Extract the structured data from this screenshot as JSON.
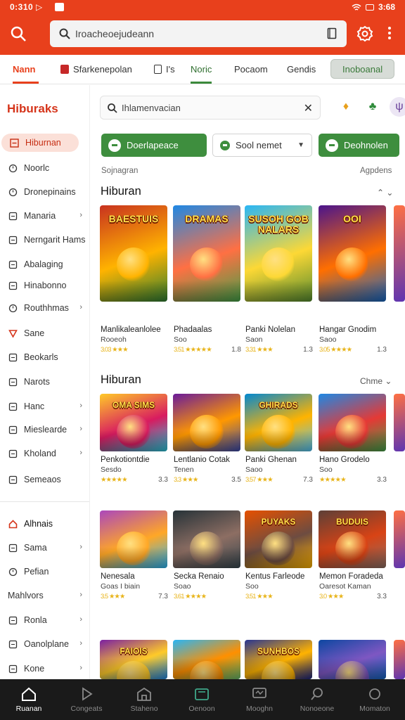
{
  "status_bar": {
    "time": "0:310 ▷",
    "right": "3:68"
  },
  "app_bar": {
    "search_text": "Iroacheoejudeann"
  },
  "tabs": [
    {
      "label": "Nann"
    },
    {
      "label": "Sfarkenepolan"
    },
    {
      "label": "I's"
    },
    {
      "label": "Noric"
    },
    {
      "label": "Pocaom"
    },
    {
      "label": "Gendis"
    },
    {
      "label": "Inoboanal"
    }
  ],
  "sidebar": {
    "title": "Hiburaks",
    "items": [
      {
        "label": "Hiburnan",
        "icon": "list-icon"
      },
      {
        "label": "Noorlc",
        "icon": "clock-icon"
      },
      {
        "label": "Dronepinains",
        "icon": "timer-icon"
      },
      {
        "label": "Manaria",
        "icon": "globe-icon"
      },
      {
        "label": "Nerngarit Hams",
        "icon": "pencil-icon"
      },
      {
        "label": "Abalaging",
        "icon": "chat-icon"
      },
      {
        "label": "Hinabonno",
        "icon": "bookmark-icon"
      },
      {
        "label": "Routhhmas",
        "icon": "clock-icon"
      },
      {
        "label": "Sane",
        "icon": "shield-icon"
      },
      {
        "label": "Beokarls",
        "icon": "book-icon"
      },
      {
        "label": "Narots",
        "icon": "gamepad-icon"
      },
      {
        "label": "Hanc",
        "icon": "controller-icon"
      },
      {
        "label": "Mieslearde",
        "icon": "doc-icon"
      },
      {
        "label": "Kholand",
        "icon": "puzzle-icon"
      },
      {
        "label": "Semeaos",
        "icon": "cards-icon"
      },
      {
        "label": "Alhnais",
        "icon": "home-icon"
      },
      {
        "label": "Sama",
        "icon": "doc-icon"
      },
      {
        "label": "Pefian",
        "icon": "circle-icon"
      },
      {
        "label": "Mahlvors",
        "icon": "none"
      },
      {
        "label": "Ronla",
        "icon": "square-icon"
      },
      {
        "label": "Oanolplane",
        "icon": "doc-icon"
      },
      {
        "label": "Kone",
        "icon": "square-icon"
      }
    ]
  },
  "main": {
    "search_text": "Ihlamenvacian",
    "filters": [
      {
        "label": "Doerlapeace"
      },
      {
        "label": "Sool nemet"
      },
      {
        "label": "Deohnolen"
      }
    ],
    "sub_left": "Sojnagran",
    "sub_right": "Agpdens",
    "sections": [
      {
        "title": "Hiburan",
        "action": "⌃ ⌄",
        "cards": [
          {
            "art_title": "BAESTUIS",
            "name": "Manlikaleanlolee",
            "sub": "Rooeoh",
            "meta": "3.03 ★★★",
            "num": "",
            "colors": [
              "#c8321f",
              "#ffb300",
              "#2e7d32"
            ]
          },
          {
            "art_title": "DRAMAS",
            "name": "Phadaalas",
            "sub": "Soo",
            "meta": "3.51 ★★★★★",
            "num": "1.8",
            "colors": [
              "#1e88e5",
              "#ff7043",
              "#43a047"
            ]
          },
          {
            "art_title": "SUSOH GOB NALARS",
            "name": "Panki Nolelan",
            "sub": "Saon",
            "meta": "3.31 ★★★",
            "num": "1.3",
            "colors": [
              "#29b6f6",
              "#fdd835",
              "#558b2f"
            ]
          },
          {
            "art_title": "OOI",
            "name": "Hangar Gnodim",
            "sub": "Saoo",
            "meta": "3.05 ★★★★",
            "num": "1.3",
            "colors": [
              "#4a148c",
              "#ff6f00",
              "#1565c0"
            ]
          }
        ]
      },
      {
        "title": "Hiburan",
        "action": "Chme ⌄",
        "cards": [
          {
            "art_title": "OMA SIMS",
            "name": "Penkotiontdie",
            "sub": "Sesdo",
            "meta": "★★★★★",
            "num": "3.3",
            "colors": [
              "#ffca28",
              "#d81b60",
              "#26c6da"
            ]
          },
          {
            "art_title": "",
            "name": "Lentlanio Cotak",
            "sub": "Tenen",
            "meta": "3.3 ★★★",
            "num": "3.5",
            "colors": [
              "#6a1b9a",
              "#ff9800",
              "#3949ab"
            ]
          },
          {
            "art_title": "GHIRADS",
            "name": "Panki Ghenan",
            "sub": "Saoo",
            "meta": "3.57 ★★★",
            "num": "7.3",
            "colors": [
              "#0288d1",
              "#ffb300",
              "#4fc3f7"
            ]
          },
          {
            "art_title": "",
            "name": "Hano Grodelo",
            "sub": "Soo",
            "meta": "★★★★★",
            "num": "3.3",
            "colors": [
              "#1e88e5",
              "#e53935",
              "#43a047"
            ]
          }
        ]
      },
      {
        "title": "",
        "action": "",
        "cards": [
          {
            "art_title": "",
            "name": "Nenesala",
            "sub": "Goas I biain",
            "meta": "3.5 ★★★",
            "num": "7.3",
            "colors": [
              "#ab47bc",
              "#ffa726",
              "#29b6f6"
            ]
          },
          {
            "art_title": "",
            "name": "Secka Renaio",
            "sub": "Soao",
            "meta": "3.61 ★★★★",
            "num": "",
            "colors": [
              "#263238",
              "#8d6e63",
              "#37474f"
            ]
          },
          {
            "art_title": "PUYAKS",
            "name": "Kentus Farleode",
            "sub": "Soo",
            "meta": "3.51 ★★★",
            "num": "",
            "colors": [
              "#e65100",
              "#6d4c41",
              "#ffb300"
            ]
          },
          {
            "art_title": "BUDUIS",
            "name": "Memon Foradeda",
            "sub": "Oaresot Kaman",
            "meta": "3.0 ★★★",
            "num": "3.3",
            "colors": [
              "#5d4037",
              "#d84315",
              "#8d6e63"
            ]
          }
        ]
      },
      {
        "title": "",
        "action": "",
        "cards": [
          {
            "art_title": "FAIOIS",
            "name": "",
            "sub": "",
            "meta": "",
            "num": "",
            "colors": [
              "#7b1fa2",
              "#ffca28",
              "#1e88e5"
            ]
          },
          {
            "art_title": "",
            "name": "",
            "sub": "",
            "meta": "",
            "num": "",
            "colors": [
              "#29b6f6",
              "#ff8f00",
              "#66bb6a"
            ]
          },
          {
            "art_title": "SUNHBOS",
            "name": "",
            "sub": "",
            "meta": "",
            "num": "",
            "colors": [
              "#283593",
              "#ffb300",
              "#1a237e"
            ]
          },
          {
            "art_title": "",
            "name": "",
            "sub": "",
            "meta": "",
            "num": "",
            "colors": [
              "#0d47a1",
              "#7e57c2",
              "#1565c0"
            ]
          }
        ]
      }
    ]
  },
  "bottom_nav": [
    {
      "label": "Ruanan",
      "icon": "home-icon"
    },
    {
      "label": "Congeats",
      "icon": "play-icon"
    },
    {
      "label": "Staheno",
      "icon": "store-icon"
    },
    {
      "label": "Oenoon",
      "icon": "tablet-icon"
    },
    {
      "label": "Mooghn",
      "icon": "monitor-icon"
    },
    {
      "label": "Nonoeone",
      "icon": "search-icon"
    },
    {
      "label": "Momaton",
      "icon": "user-icon"
    }
  ]
}
